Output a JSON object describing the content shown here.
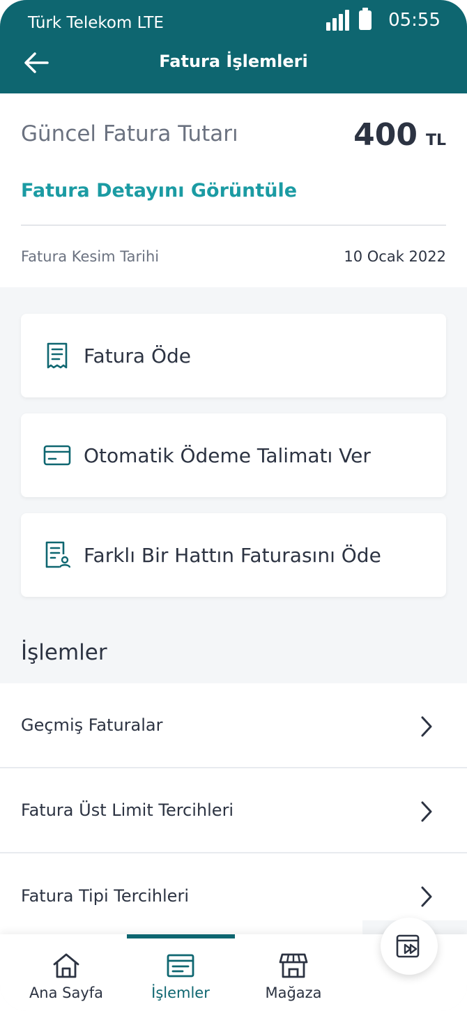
{
  "status_bar": {
    "carrier": "Türk Telekom LTE",
    "time": "05:55"
  },
  "header": {
    "title": "Fatura İşlemleri",
    "back_icon": "arrow-left-icon"
  },
  "summary": {
    "label": "Güncel Fatura Tutarı",
    "amount": "400",
    "currency": "TL",
    "detail_link": "Fatura Detayını Görüntüle",
    "cut_date_label": "Fatura Kesim Tarihi",
    "cut_date_value": "10 Ocak 2022"
  },
  "actions": [
    {
      "label": "Fatura Öde",
      "icon": "receipt-icon"
    },
    {
      "label": "Otomatik Ödeme Talimatı Ver",
      "icon": "credit-card-icon"
    },
    {
      "label": "Farklı Bir Hattın Faturasını Öde",
      "icon": "document-user-icon"
    }
  ],
  "section": {
    "title": "İşlemler"
  },
  "list": [
    {
      "label": "Geçmiş Faturalar"
    },
    {
      "label": "Fatura Üst Limit Tercihleri"
    },
    {
      "label": "Fatura Tipi Tercihleri"
    }
  ],
  "nav": [
    {
      "label": "Ana Sayfa",
      "icon": "home-icon"
    },
    {
      "label": "İşlemler",
      "icon": "transactions-icon",
      "active": true
    },
    {
      "label": "Mağaza",
      "icon": "store-icon"
    }
  ],
  "fab": {
    "icon": "media-play-icon"
  },
  "colors": {
    "primary": "#0e6670",
    "link": "#1b9ba3",
    "text": "#2c3342",
    "muted": "#6b7280"
  }
}
